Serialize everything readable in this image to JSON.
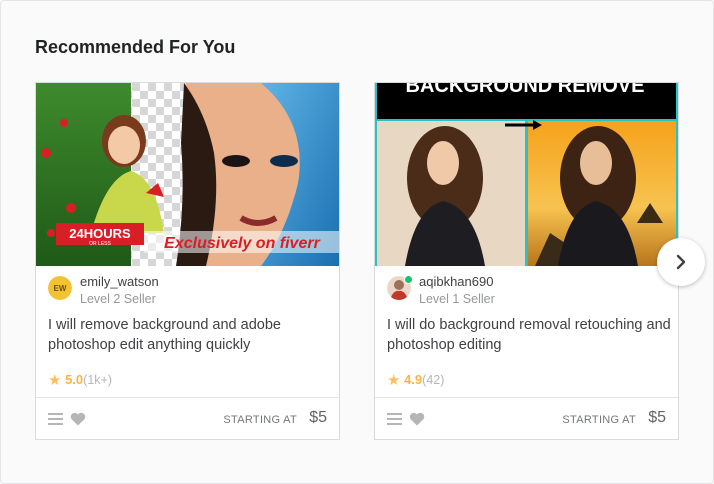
{
  "section": {
    "title": "Recommended For You"
  },
  "gigs": [
    {
      "thumbnail_overlay": "24HOURS",
      "thumbnail_overlay_sub": "OR LESS",
      "thumbnail_watermark": "Exclusively on fiverr",
      "seller_name": "emily_watson",
      "seller_level": "Level 2 Seller",
      "avatar_initials": "EW",
      "title": "I will remove background and adobe photoshop edit anything quickly",
      "rating": "5.0",
      "rating_count": "(1k+)",
      "starting_at_label": "STARTING AT",
      "price": "$5"
    },
    {
      "thumbnail_overlay": "BACKGROUND REMOVE",
      "seller_name": "aqibkhan690",
      "seller_level": "Level 1 Seller",
      "online": true,
      "title": "I will do background removal retouching and photoshop editing",
      "rating": "4.9",
      "rating_count": "(42)",
      "starting_at_label": "STARTING AT",
      "price": "$5"
    }
  ],
  "icons": {
    "rating": "star-icon",
    "collections": "menu-icon",
    "favorite": "heart-icon",
    "next": "chevron-right-icon"
  },
  "colors": {
    "rating": "#ffb33e",
    "online": "#1dbf73",
    "text": "#404145",
    "muted": "#95979d"
  }
}
